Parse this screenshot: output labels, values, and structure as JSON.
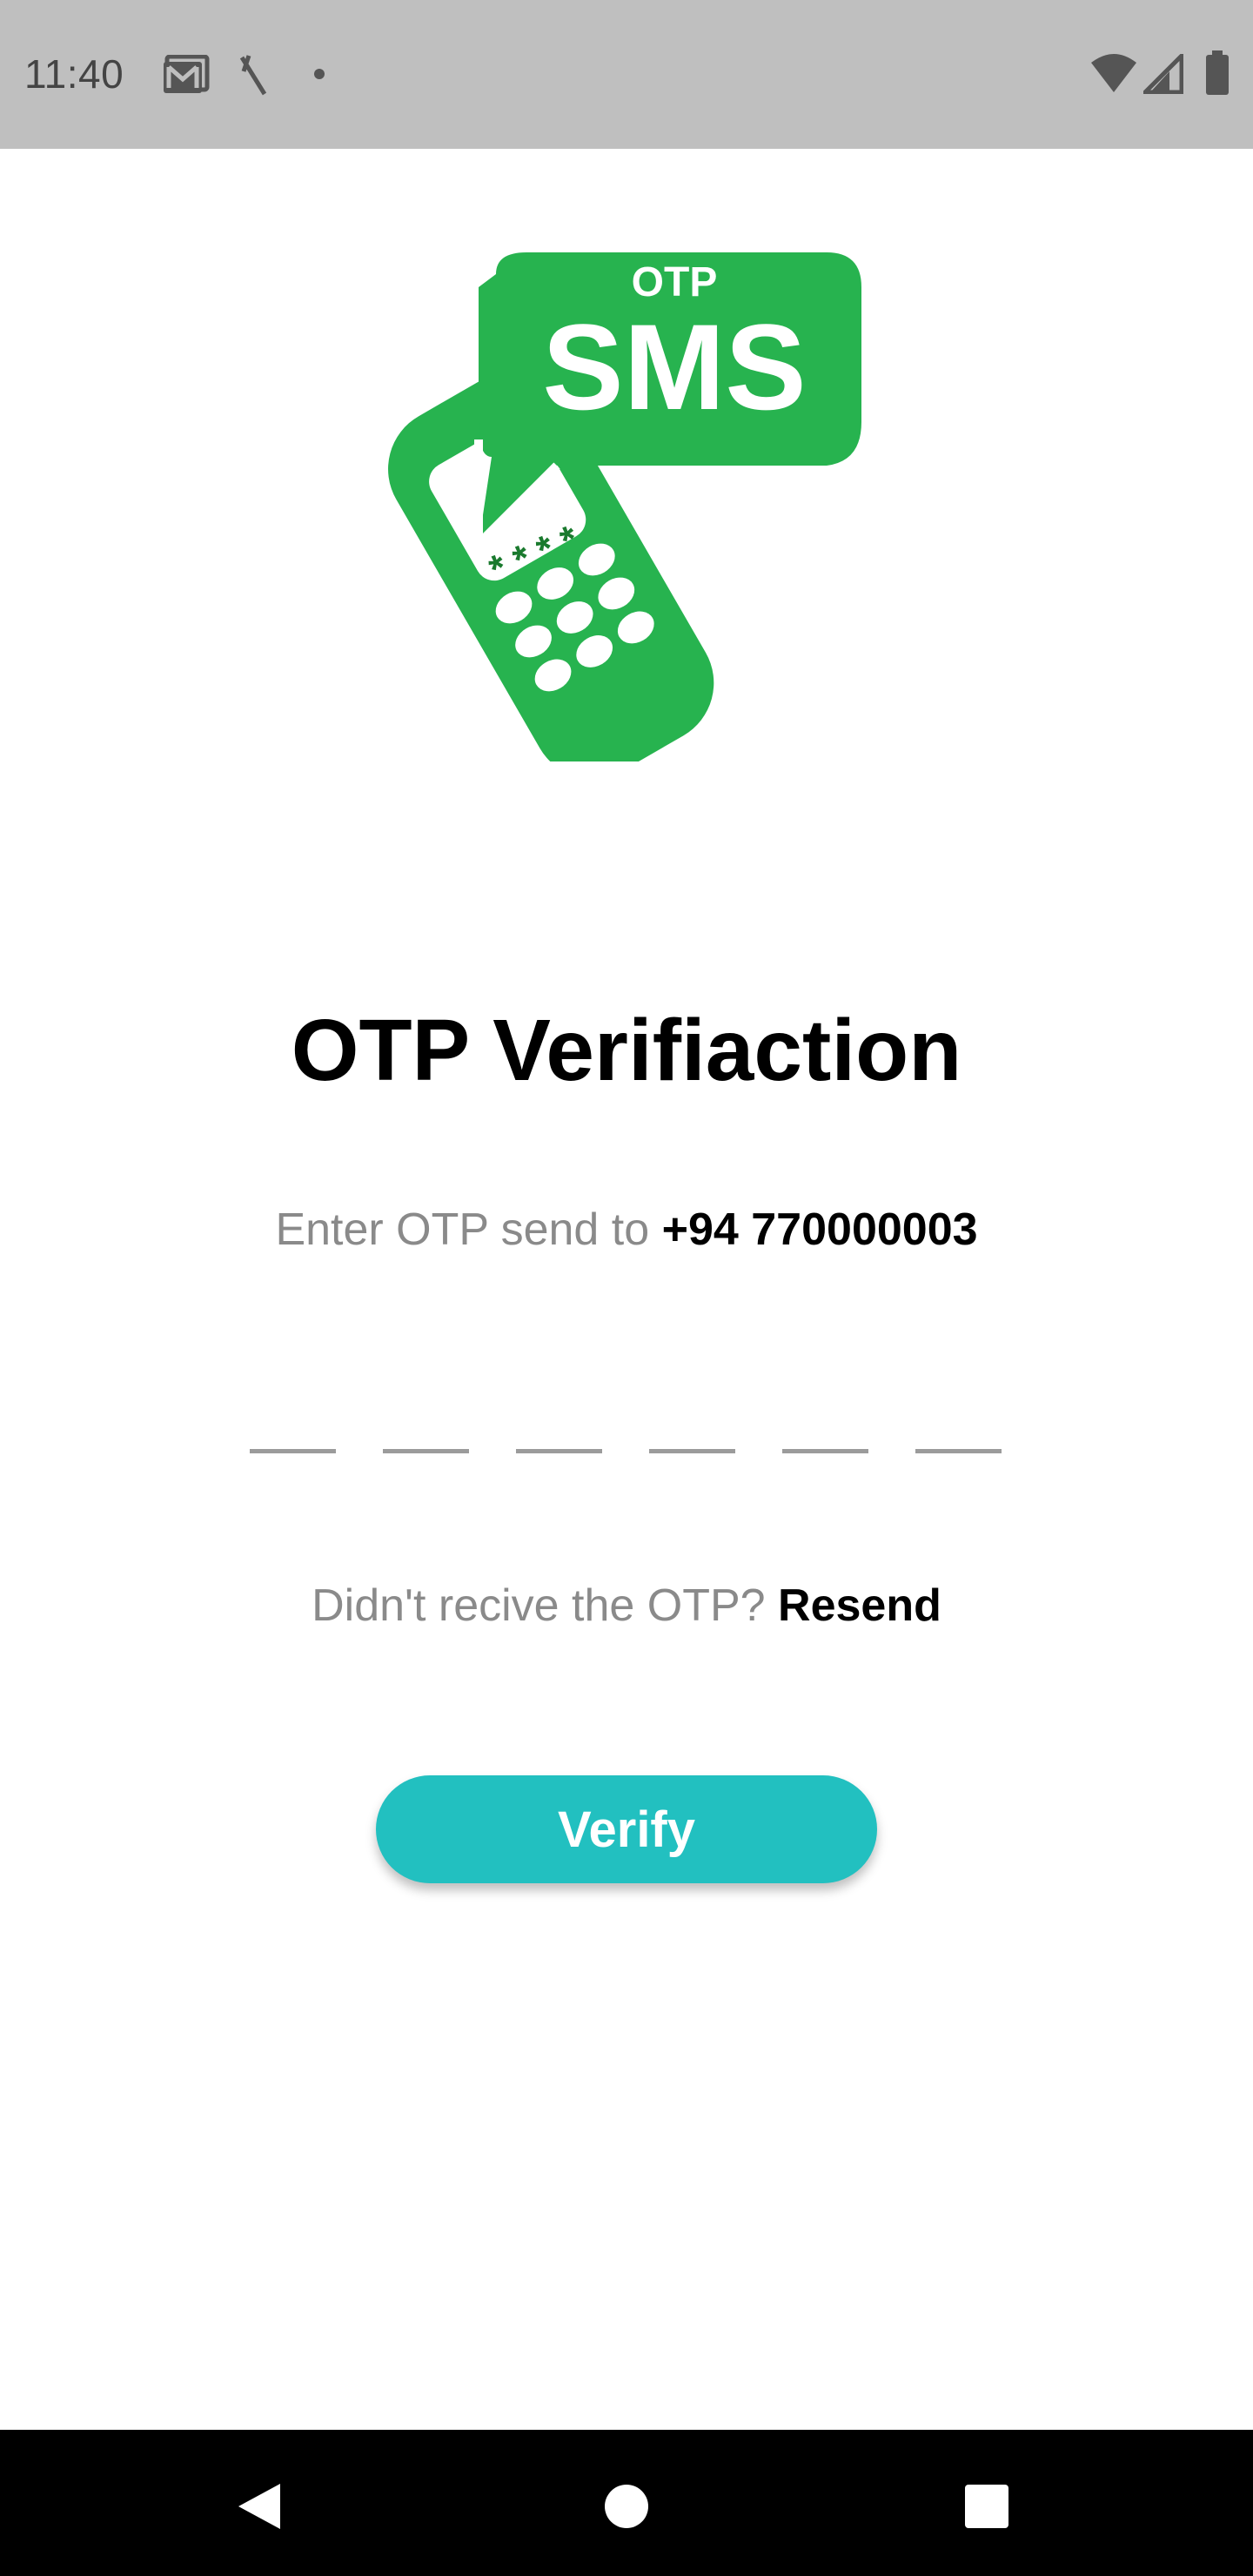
{
  "status_bar": {
    "time": "11:40",
    "icons": [
      "gmail-icon",
      "no-signal-slash-icon",
      "dot-icon",
      "wifi-icon",
      "cell-signal-icon",
      "battery-icon"
    ]
  },
  "logo": {
    "top_text": "OTP",
    "main_text": "SMS",
    "screen_text": "* * * *",
    "brand_color": "#27b34f",
    "screen_text_color": "#1a7a2e"
  },
  "title": "OTP Verifiaction",
  "subtitle": {
    "prefix": "Enter OTP send to ",
    "phone": "+94 770000003"
  },
  "otp_inputs": [
    "",
    "",
    "",
    "",
    "",
    ""
  ],
  "resend": {
    "prefix": "Didn't recive the OTP? ",
    "link_label": "Resend"
  },
  "verify_button": {
    "label": "Verify",
    "color": "#22c0c0"
  },
  "nav_bar": {
    "icons": [
      "back-triangle-icon",
      "home-circle-icon",
      "recents-square-icon"
    ]
  }
}
